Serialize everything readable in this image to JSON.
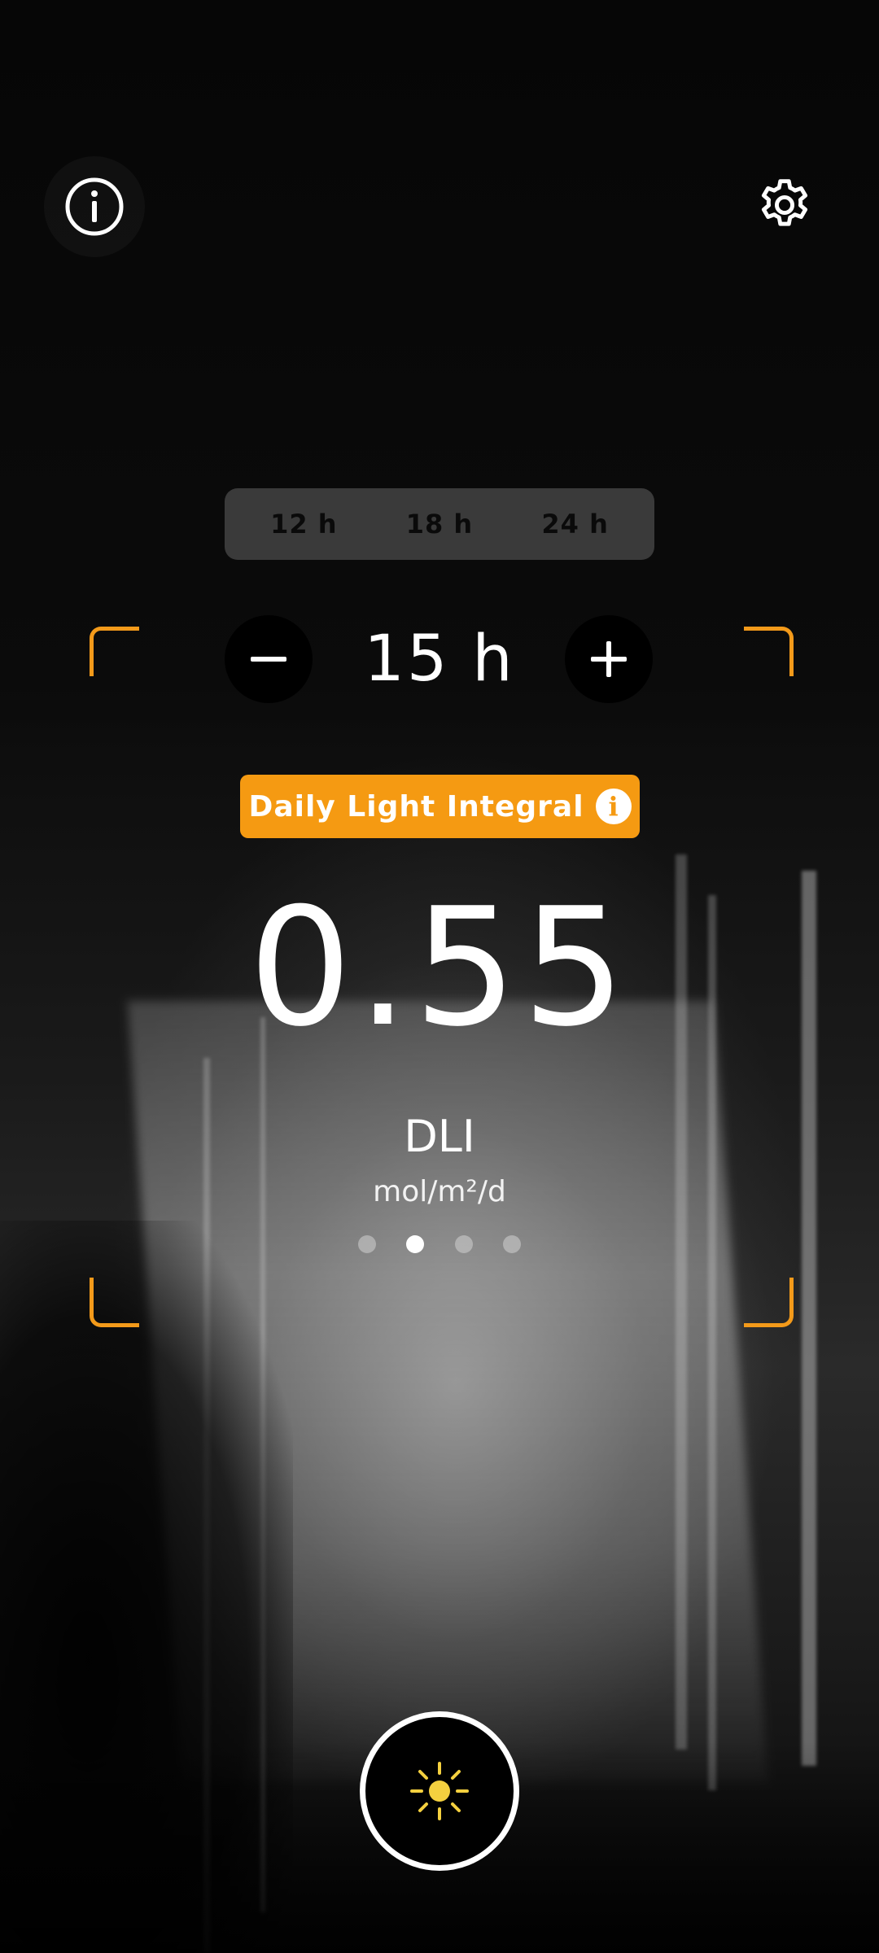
{
  "top_bar": {
    "info_icon": "info-circle-icon",
    "settings_icon": "gear-icon"
  },
  "presets": [
    {
      "label": "12 h"
    },
    {
      "label": "18 h"
    },
    {
      "label": "24 h"
    }
  ],
  "hours_stepper": {
    "value_label": "15 h",
    "decrement_icon": "minus-icon",
    "increment_icon": "plus-icon"
  },
  "metric_badge": {
    "label": "Daily Light Integral",
    "info_glyph": "i"
  },
  "reading": {
    "value": "0.55",
    "unit_name": "DLI",
    "unit": "mol/m²/d"
  },
  "pager": {
    "total": 4,
    "active_index": 1
  },
  "capture_button": {
    "icon": "sun-icon"
  },
  "colors": {
    "accent": "#f59a12",
    "sun_icon": "#f4d03f",
    "frame": "#f39a1a"
  }
}
